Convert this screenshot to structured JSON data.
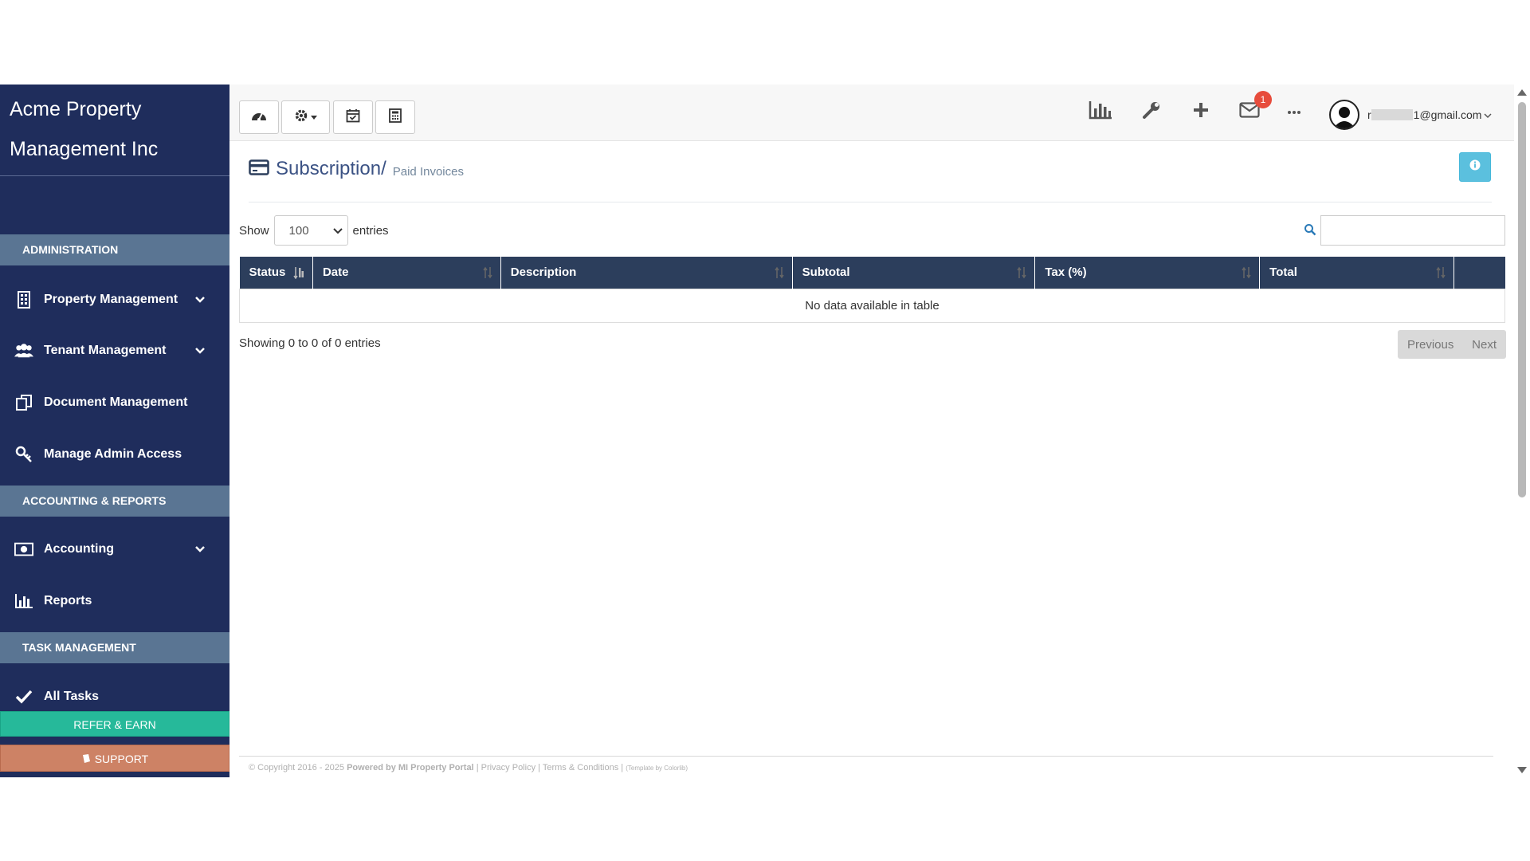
{
  "sidebar": {
    "brand_line1": "Acme Property",
    "brand_line2": "Management Inc",
    "sections": {
      "administration": "ADMINISTRATION",
      "accounting_reports": "ACCOUNTING & REPORTS",
      "task_management": "TASK MANAGEMENT"
    },
    "items": {
      "property_management": "Property Management",
      "tenant_management": "Tenant Management",
      "document_management": "Document Management",
      "manage_admin_access": "Manage Admin Access",
      "accounting": "Accounting",
      "reports": "Reports",
      "all_tasks": "All Tasks"
    },
    "refer_label": "REFER & EARN",
    "support_label": "SUPPORT"
  },
  "topbar": {
    "mail_badge": "1",
    "email_visible": "1@gmail.com"
  },
  "page": {
    "title": "Subscription/",
    "subtitle": "Paid Invoices"
  },
  "table": {
    "show_label": "Show",
    "entries_value": "100",
    "entries_label": "entries",
    "columns": [
      "Status",
      "Date",
      "Description",
      "Subtotal",
      "Tax (%)",
      "Total"
    ],
    "empty_message": "No data available in table",
    "info": "Showing 0 to 0 of 0 entries",
    "prev_label": "Previous",
    "next_label": "Next"
  },
  "footer": {
    "copyright": "© Copyright 2016 - 2025",
    "powered": "Powered by MI Property Portal",
    "sep1": "|",
    "privacy": "Privacy Policy",
    "sep2": "|",
    "terms": "Terms & Conditions",
    "sep3": "|",
    "template": "(Template by Colorlib)"
  },
  "colors": {
    "sidebar_bg": "#1f2d5c",
    "section_bg": "#5a7593",
    "table_header_bg": "#2c3e5c",
    "refer_bg": "#26b99a",
    "support_bg": "#cd8265",
    "info_btn_bg": "#5bc0de",
    "badge_bg": "#e74c3c",
    "title_color": "#3b5284"
  },
  "icons": {
    "toolbar": [
      "dashboard-icon",
      "settings-gear-icon",
      "calendar-check-icon",
      "calculator-icon"
    ],
    "top_right": [
      "bar-chart-icon",
      "wrench-icon",
      "plus-icon",
      "mail-icon",
      "more-icon"
    ],
    "page": "credit-card-icon",
    "info": "info-circle-icon",
    "search": "search-icon"
  }
}
